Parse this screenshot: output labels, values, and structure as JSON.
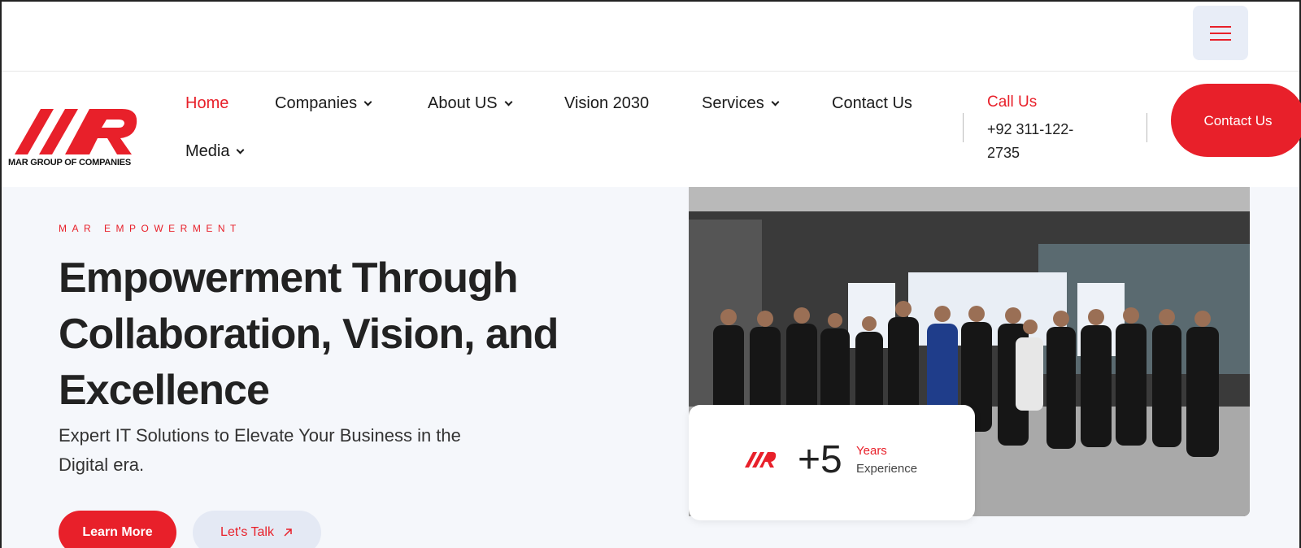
{
  "header": {
    "logo_text": "MAR GROUP OF COMPANIES",
    "nav": [
      {
        "label": "Home",
        "active": true,
        "dropdown": false
      },
      {
        "label": "Companies",
        "active": false,
        "dropdown": true
      },
      {
        "label": "About US",
        "active": false,
        "dropdown": true
      },
      {
        "label": "Vision 2030",
        "active": false,
        "dropdown": false
      },
      {
        "label": "Services",
        "active": false,
        "dropdown": true
      },
      {
        "label": "Contact Us",
        "active": false,
        "dropdown": false
      },
      {
        "label": "Media",
        "active": false,
        "dropdown": true
      }
    ],
    "call_label": "Call Us",
    "call_number": "+92 311-122-2735",
    "contact_button": "Contact Us"
  },
  "hero": {
    "eyebrow": "MAR EMPOWERMENT",
    "title": "Empowerment Through Collaboration, Vision, and Excellence",
    "subtitle": "Expert IT Solutions to Elevate Your Business in the Digital era.",
    "learn_more": "Learn More",
    "lets_talk": "Let's Talk",
    "experience": {
      "number": "+5",
      "years": "Years",
      "label": "Experience"
    }
  },
  "colors": {
    "brand_red": "#e8202a",
    "light_blue": "#e8edf7",
    "hero_bg": "#f5f7fb"
  }
}
